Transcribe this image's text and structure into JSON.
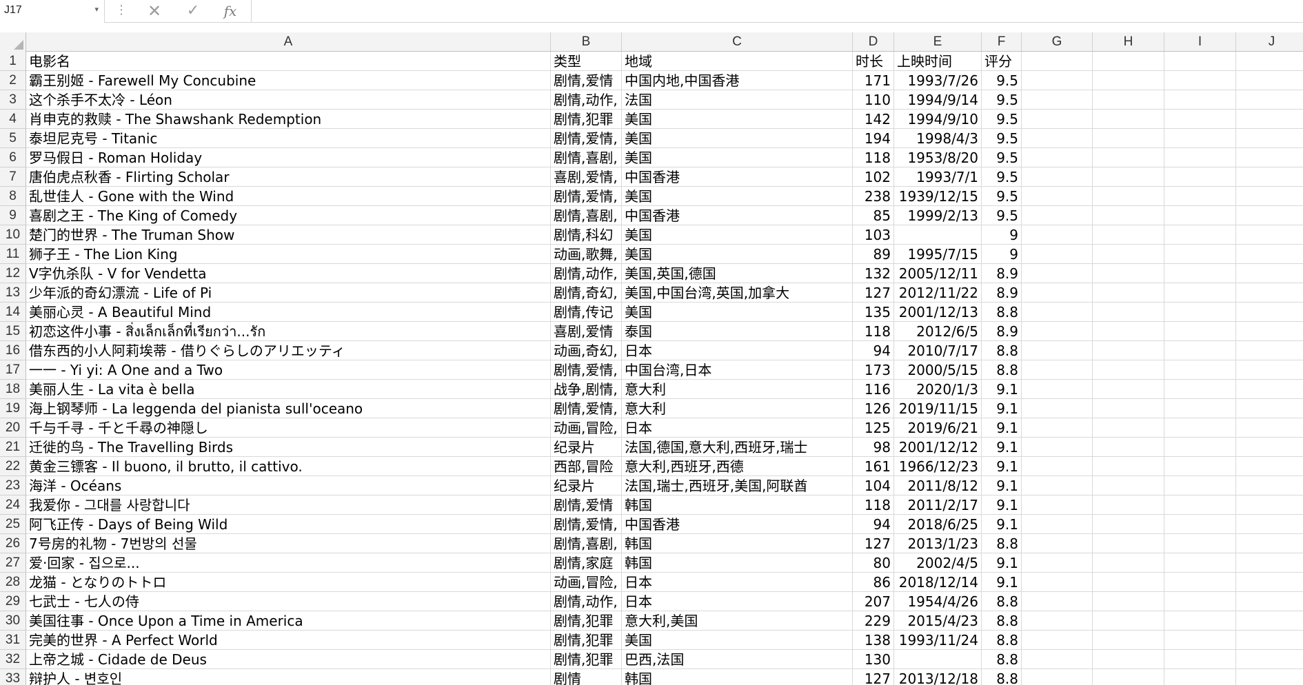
{
  "formula_bar": {
    "name_box": "J17",
    "name_box_dropdown": "▾",
    "more_options": "⋮",
    "cancel_icon": "✕",
    "enter_icon": "✓",
    "function_label": "fx",
    "formula": ""
  },
  "columns": [
    {
      "label": "A"
    },
    {
      "label": "B"
    },
    {
      "label": "C"
    },
    {
      "label": "D"
    },
    {
      "label": "E"
    },
    {
      "label": "F"
    },
    {
      "label": "G"
    },
    {
      "label": "H"
    },
    {
      "label": "I"
    },
    {
      "label": "J"
    }
  ],
  "rows": [
    [
      "1",
      "电影名",
      "类型",
      "地域",
      "时长",
      "上映时间",
      "评分"
    ],
    [
      "2",
      "霸王别姬 - Farewell My Concubine",
      "剧情,爱情",
      "中国内地,中国香港",
      "171",
      "1993/7/26",
      "9.5"
    ],
    [
      "3",
      "这个杀手不太冷 - Léon",
      "剧情,动作,",
      "法国",
      "110",
      "1994/9/14",
      "9.5"
    ],
    [
      "4",
      "肖申克的救赎 - The Shawshank Redemption",
      "剧情,犯罪",
      "美国",
      "142",
      "1994/9/10",
      "9.5"
    ],
    [
      "5",
      "泰坦尼克号 - Titanic",
      "剧情,爱情,",
      "美国",
      "194",
      "1998/4/3",
      "9.5"
    ],
    [
      "6",
      "罗马假日 - Roman Holiday",
      "剧情,喜剧,",
      "美国",
      "118",
      "1953/8/20",
      "9.5"
    ],
    [
      "7",
      "唐伯虎点秋香 - Flirting Scholar",
      "喜剧,爱情,",
      "中国香港",
      "102",
      "1993/7/1",
      "9.5"
    ],
    [
      "8",
      "乱世佳人 - Gone with the Wind",
      "剧情,爱情,",
      "美国",
      "238",
      "1939/12/15",
      "9.5"
    ],
    [
      "9",
      "喜剧之王 - The King of Comedy",
      "剧情,喜剧,",
      "中国香港",
      "85",
      "1999/2/13",
      "9.5"
    ],
    [
      "10",
      "楚门的世界 - The Truman Show",
      "剧情,科幻",
      "美国",
      "103",
      "",
      "9"
    ],
    [
      "11",
      "狮子王 - The Lion King",
      "动画,歌舞,",
      "美国",
      "89",
      "1995/7/15",
      "9"
    ],
    [
      "12",
      "V字仇杀队 - V for Vendetta",
      "剧情,动作,",
      "美国,英国,德国",
      "132",
      "2005/12/11",
      "8.9"
    ],
    [
      "13",
      "少年派的奇幻漂流 - Life of Pi",
      "剧情,奇幻,",
      "美国,中国台湾,英国,加拿大",
      "127",
      "2012/11/22",
      "8.9"
    ],
    [
      "14",
      "美丽心灵 - A Beautiful Mind",
      "剧情,传记",
      "美国",
      "135",
      "2001/12/13",
      "8.8"
    ],
    [
      "15",
      "初恋这件小事 - สิ่งเล็กเล็กที่เรียกว่า...รัก",
      "喜剧,爱情",
      "泰国",
      "118",
      "2012/6/5",
      "8.9"
    ],
    [
      "16",
      "借东西的小人阿莉埃蒂 - 借りぐらしのアリエッティ",
      "动画,奇幻,",
      "日本",
      "94",
      "2010/7/17",
      "8.8"
    ],
    [
      "17",
      "一一 - Yi yi: A One and a Two",
      "剧情,爱情,",
      "中国台湾,日本",
      "173",
      "2000/5/15",
      "8.8"
    ],
    [
      "18",
      "美丽人生 - La vita è bella",
      "战争,剧情,",
      "意大利",
      "116",
      "2020/1/3",
      "9.1"
    ],
    [
      "19",
      "海上钢琴师 - La leggenda del pianista sull'oceano",
      "剧情,爱情,",
      "意大利",
      "126",
      "2019/11/15",
      "9.1"
    ],
    [
      "20",
      "千与千寻 - 千と千尋の神隠し",
      "动画,冒险,",
      "日本",
      "125",
      "2019/6/21",
      "9.1"
    ],
    [
      "21",
      "迁徙的鸟 - The Travelling Birds",
      "纪录片",
      "法国,德国,意大利,西班牙,瑞士",
      "98",
      "2001/12/12",
      "9.1"
    ],
    [
      "22",
      "黄金三镖客 - Il buono, il brutto, il cattivo.",
      "西部,冒险",
      "意大利,西班牙,西德",
      "161",
      "1966/12/23",
      "9.1"
    ],
    [
      "23",
      "海洋 - Océans",
      "纪录片",
      "法国,瑞士,西班牙,美国,阿联酋",
      "104",
      "2011/8/12",
      "9.1"
    ],
    [
      "24",
      "我爱你 - 그대를 사랑합니다",
      "剧情,爱情",
      "韩国",
      "118",
      "2011/2/17",
      "9.1"
    ],
    [
      "25",
      "阿飞正传 - Days of Being Wild",
      "剧情,爱情,",
      "中国香港",
      "94",
      "2018/6/25",
      "9.1"
    ],
    [
      "26",
      "7号房的礼物 - 7번방의 선물",
      "剧情,喜剧,",
      "韩国",
      "127",
      "2013/1/23",
      "8.8"
    ],
    [
      "27",
      "爱·回家 - 집으로...",
      "剧情,家庭",
      "韩国",
      "80",
      "2002/4/5",
      "9.1"
    ],
    [
      "28",
      "龙猫 - となりのトトロ",
      "动画,冒险,",
      "日本",
      "86",
      "2018/12/14",
      "9.1"
    ],
    [
      "29",
      "七武士 - 七人の侍",
      "剧情,动作,",
      "日本",
      "207",
      "1954/4/26",
      "8.8"
    ],
    [
      "30",
      "美国往事 - Once Upon a Time in America",
      "剧情,犯罪",
      "意大利,美国",
      "229",
      "2015/4/23",
      "8.8"
    ],
    [
      "31",
      "完美的世界 - A Perfect World",
      "剧情,犯罪",
      "美国",
      "138",
      "1993/11/24",
      "8.8"
    ],
    [
      "32",
      "上帝之城 - Cidade de Deus",
      "剧情,犯罪",
      "巴西,法国",
      "130",
      "",
      "8.8"
    ],
    [
      "33",
      "辩护人 - 변호인",
      "剧情",
      "韩国",
      "127",
      "2013/12/18",
      "8.8"
    ]
  ]
}
